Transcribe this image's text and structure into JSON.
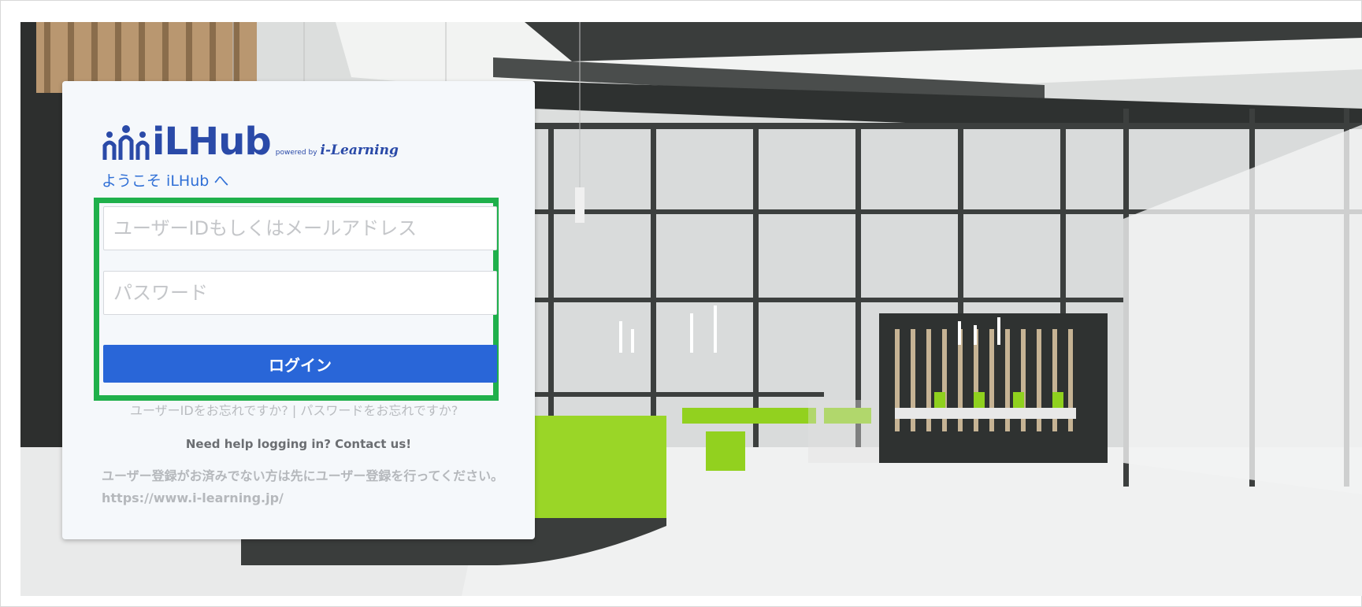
{
  "logo": {
    "name": "iLHub",
    "powered_by": "powered by",
    "brand": "i-Learning"
  },
  "welcome_text": "ようこそ iLHub へ",
  "form": {
    "user_placeholder": "ユーザーIDもしくはメールアドレス",
    "password_placeholder": "パスワード",
    "login_label": "ログイン"
  },
  "links": {
    "forgot_id": "ユーザーIDをお忘れですか?",
    "separator": "|",
    "forgot_password": "パスワードをお忘れですか?"
  },
  "help_text": "Need help logging in? Contact us!",
  "register_note": "ユーザー登録がお済みでない方は先にユーザー登録を行ってください。https://www.i-learning.jp/",
  "colors": {
    "accent": "#2966d8",
    "logo": "#2a4aa8",
    "highlight": "#1fb04b",
    "welcome": "#2f6fd6"
  }
}
